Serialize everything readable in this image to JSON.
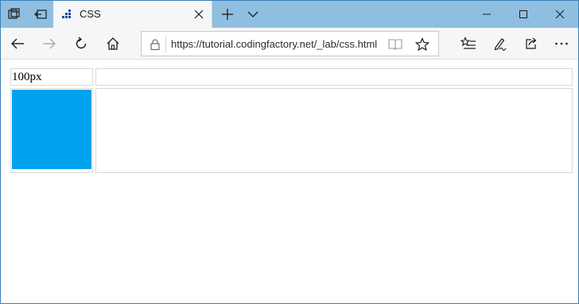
{
  "browser": {
    "tab": {
      "title": "CSS"
    },
    "address_bar": {
      "url": "https://tutorial.codingfactory.net/_lab/css.html"
    },
    "icons": {
      "titlebar": [
        "tab-actions-icon",
        "set-aside-tabs-icon",
        "new-tab-icon",
        "tab-preview-icon"
      ],
      "nav": [
        "back-icon",
        "forward-icon",
        "refresh-icon",
        "home-icon"
      ],
      "toolbar": [
        "favorites-list-icon",
        "pen-icon",
        "share-icon",
        "more-icon"
      ]
    }
  },
  "page": {
    "table": {
      "header_label": "100px",
      "box_color": "#00a2ed"
    }
  }
}
